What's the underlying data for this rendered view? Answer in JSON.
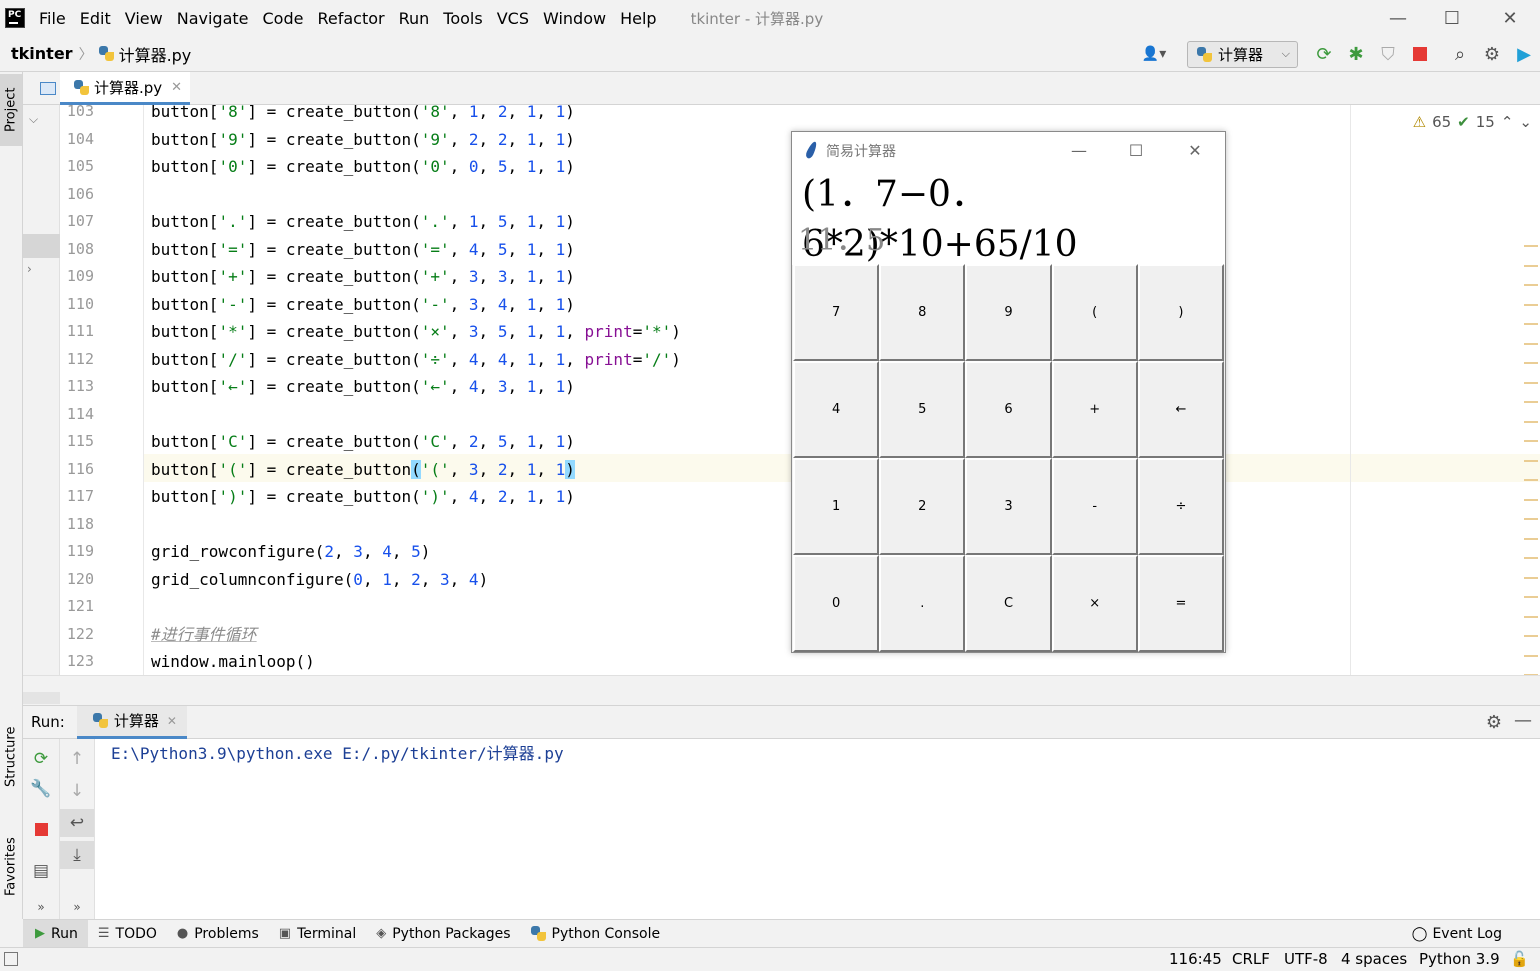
{
  "menubar": {
    "logo_text": "PC",
    "items": [
      "File",
      "Edit",
      "View",
      "Navigate",
      "Code",
      "Refactor",
      "Run",
      "Tools",
      "VCS",
      "Window",
      "Help"
    ],
    "window_title": "tkinter - 计算器.py"
  },
  "navbar": {
    "project": "tkinter",
    "file": "计算器.py",
    "run_config": "计算器"
  },
  "left_stripe": {
    "project": "Project",
    "structure": "Structure",
    "favorites": "Favorites"
  },
  "editor": {
    "tab_label": "计算器.py",
    "inspections": {
      "warnings": "65",
      "typos": "15"
    },
    "lines": [
      {
        "no": "103",
        "code": "button['8'] = create_button('8', 1, 2, 1, 1)"
      },
      {
        "no": "104",
        "code": "button['9'] = create_button('9', 2, 2, 1, 1)"
      },
      {
        "no": "105",
        "code": "button['0'] = create_button('0', 0, 5, 1, 1)"
      },
      {
        "no": "106",
        "code": ""
      },
      {
        "no": "107",
        "code": "button['.'] = create_button('.', 1, 5, 1, 1)"
      },
      {
        "no": "108",
        "code": "button['='] = create_button('=', 4, 5, 1, 1)"
      },
      {
        "no": "109",
        "code": "button['+'] = create_button('+', 3, 3, 1, 1)"
      },
      {
        "no": "110",
        "code": "button['-'] = create_button('-', 3, 4, 1, 1)"
      },
      {
        "no": "111",
        "code": "button['*'] = create_button('×', 3, 5, 1, 1, print='*')"
      },
      {
        "no": "112",
        "code": "button['/'] = create_button('÷', 4, 4, 1, 1, print='/')"
      },
      {
        "no": "113",
        "code": "button['←'] = create_button('←', 4, 3, 1, 1)"
      },
      {
        "no": "114",
        "code": ""
      },
      {
        "no": "115",
        "code": "button['C'] = create_button('C', 2, 5, 1, 1)"
      },
      {
        "no": "116",
        "code": "button['('] = create_button('(', 3, 2, 1, 1)"
      },
      {
        "no": "117",
        "code": "button[')'] = create_button(')', 4, 2, 1, 1)"
      },
      {
        "no": "118",
        "code": ""
      },
      {
        "no": "119",
        "code": "grid_rowconfigure(2, 3, 4, 5)"
      },
      {
        "no": "120",
        "code": "grid_columnconfigure(0, 1, 2, 3, 4)"
      },
      {
        "no": "121",
        "code": ""
      },
      {
        "no": "122",
        "code": "#进行事件循环"
      },
      {
        "no": "123",
        "code": "window.mainloop()"
      }
    ]
  },
  "calculator": {
    "title": "简易计算器",
    "expression": "(1．7−0．6*2)*10+65/10",
    "result": "11．5",
    "buttons": [
      "7",
      "8",
      "9",
      "(",
      ")",
      "4",
      "5",
      "6",
      "+",
      "←",
      "1",
      "2",
      "3",
      "-",
      "÷",
      "0",
      ".",
      "C",
      "×",
      "="
    ]
  },
  "run": {
    "label": "Run:",
    "tab": "计算器",
    "console_output": "E:\\Python3.9\\python.exe E:/.py/tkinter/计算器.py"
  },
  "bottom_tabs": {
    "run": "Run",
    "todo": "TODO",
    "problems": "Problems",
    "terminal": "Terminal",
    "python_packages": "Python Packages",
    "python_console": "Python Console",
    "event_log": "Event Log"
  },
  "statusbar": {
    "position": "116:45",
    "line_sep": "CRLF",
    "encoding": "UTF-8",
    "indent": "4 spaces",
    "interpreter": "Python 3.9"
  },
  "colors": {
    "accent": "#4a88c7",
    "string": "#067d17",
    "number": "#1750eb",
    "keyword_arg": "#871094",
    "stop_red": "#e53935",
    "run_green": "#3d9a3d"
  }
}
